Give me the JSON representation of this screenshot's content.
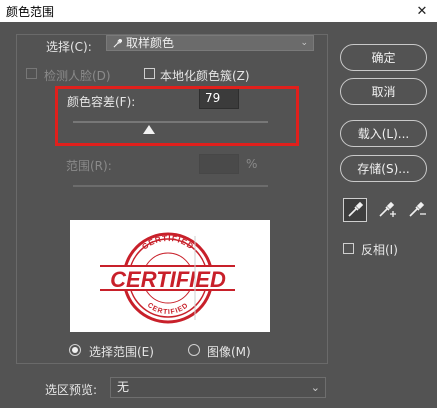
{
  "window": {
    "title": "颜色范围",
    "close_icon": "close-icon"
  },
  "select": {
    "label": "选择(C):",
    "value": "取样颜色",
    "icon": "eyedropper-icon"
  },
  "detect_faces": {
    "label": "检测人脸(D)",
    "checked": false,
    "disabled": true
  },
  "localized_clusters": {
    "label": "本地化颜色簇(Z)",
    "checked": false
  },
  "fuzziness": {
    "label": "颜色容差(F):",
    "value": "79",
    "slider_percent": 39
  },
  "range": {
    "label": "范围(R):",
    "value": "",
    "unit": "%",
    "disabled": true
  },
  "preview": {
    "image": "certified-stamp-image",
    "stamp_main": "CERTIFIED",
    "stamp_top": "CERTIFIED",
    "stamp_bottom": "CERTIFIED",
    "stamp_color": "#c8202a"
  },
  "view_mode": {
    "selection_label": "选择范围(E)",
    "image_label": "图像(M)",
    "selected": "selection"
  },
  "selection_preview": {
    "label": "选区预览:",
    "value": "无"
  },
  "buttons": {
    "ok": "确定",
    "cancel": "取消",
    "load": "载入(L)...",
    "save": "存储(S)..."
  },
  "tools": [
    "eyedropper-icon",
    "eyedropper-plus-icon",
    "eyedropper-minus-icon"
  ],
  "invert": {
    "label": "反相(I)",
    "checked": false
  },
  "colors": {
    "highlight": "#e0201c",
    "background": "#535353",
    "title_bar": "#ffffff"
  }
}
